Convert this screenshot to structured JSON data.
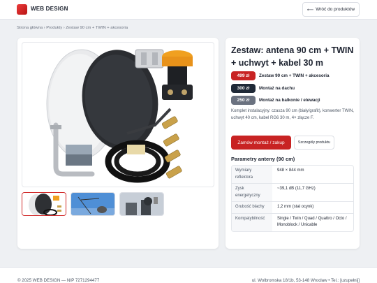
{
  "header": {
    "brand": "WEB DESIGN",
    "back_label": "Wróć do produktów",
    "back_arrow": "⟵"
  },
  "breadcrumb": "Strona główna › Produkty › Zestaw 90 cm + TWIN + akcesoria",
  "product": {
    "title": "Zestaw: antena 90 cm + TWIN + uchwyt + kabel 30 m",
    "prices": [
      {
        "amount": "499 zł",
        "label": "Zestaw 90 cm + TWIN + akcesoria",
        "color": "#c82323"
      },
      {
        "amount": "300 zł",
        "label": "Montaż na dachu",
        "color": "#1f2937"
      },
      {
        "amount": "250 zł",
        "label": "Montaż na balkonie / elewacji",
        "color": "#6b7280"
      }
    ],
    "description": "Komplet instalacyjny: czasza 90 cm (biały/grafit), konwerter TWIN, uchwyt 40 cm, kabel RG6 30 m, 4× złącze F.",
    "order_button": "Zamów montaż / zakup",
    "details_button": "Szczegóły produktu",
    "params_title": "Parametry anteny (90 cm)",
    "params": [
      {
        "key": "Wymiary reflektora",
        "value": "948 × 844 mm"
      },
      {
        "key": "Zysk energetyczny",
        "value": "~39,1 dB (11,7 GHz)"
      },
      {
        "key": "Grubość blachy",
        "value": "1,2 mm (stal ocynk)"
      },
      {
        "key": "Kompatybilność",
        "value": "Single / Twin / Quad / Quattro / Octo / Monoblock / Unicable"
      }
    ]
  },
  "gallery": {
    "main_image": "satellite-dish-kit",
    "thumbnails": [
      "dish-kit-thumbnail",
      "roof-antenna-thumbnail",
      "chimney-antenna-thumbnail"
    ]
  },
  "footer": {
    "left": "© 2025 WEB DESIGN — NIP 7271294477",
    "right": "ul. Wolbromska 18/1b, 53-148 Wrocław • Tel.: [uzupełnij]"
  },
  "colors": {
    "accent": "#c82323",
    "background": "#eef0f3",
    "text": "#1d2330"
  }
}
